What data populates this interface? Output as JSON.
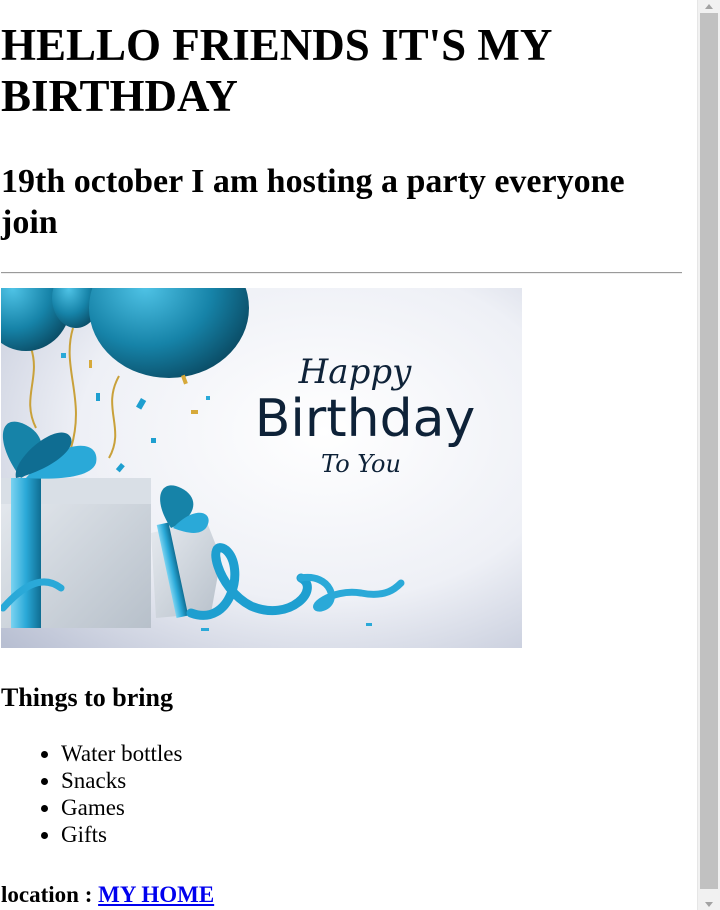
{
  "page": {
    "heading": "HELLO FRIENDS IT'S MY BIRTHDAY",
    "subheading": "19th october I am hosting a party everyone join"
  },
  "banner": {
    "line_1": "Happy",
    "line_2": "Birthday",
    "line_3": "To You"
  },
  "list": {
    "title": "Things to bring",
    "items": [
      "Water bottles",
      "Snacks",
      "Games",
      "Gifts"
    ]
  },
  "location": {
    "label": "location : ",
    "link_text": "MY HOME"
  },
  "colors": {
    "link": "#0000ee",
    "balloon": "#1683a8",
    "ribbon": "#2aa9d8",
    "banner_text": "#0e2238"
  },
  "icons": {
    "scroll_up": "chevron-up-icon",
    "scroll_down": "chevron-down-icon"
  }
}
